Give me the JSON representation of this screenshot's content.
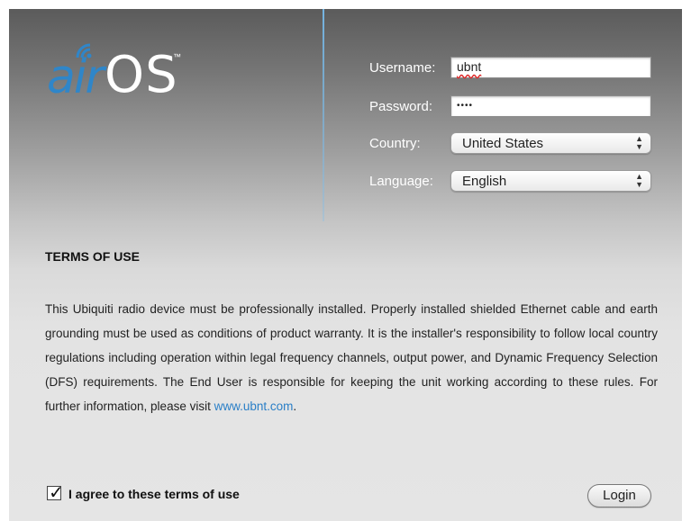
{
  "logo": {
    "air": "air",
    "os": "OS",
    "tm": "™"
  },
  "login": {
    "username_label": "Username:",
    "username_value": "ubnt",
    "password_label": "Password:",
    "password_value": "••••",
    "country_label": "Country:",
    "country_value": "United States",
    "language_label": "Language:",
    "language_value": "English"
  },
  "terms": {
    "heading": "TERMS OF USE",
    "body": "This Ubiquiti radio device must be professionally installed. Properly installed shielded Ethernet cable and earth grounding must be used as conditions of product warranty. It is the installer's responsibility to follow local country regulations including operation within legal frequency channels, output power, and Dynamic Frequency Selection (DFS) requirements. The End User is responsible for keeping the unit working according to these rules. For further information, please visit ",
    "link": "www.ubnt.com",
    "tail": "."
  },
  "agree": {
    "label": "I agree to these terms of use",
    "checked": true
  },
  "login_button": "Login",
  "colors": {
    "accent": "#2f86c9",
    "link": "#2a7fc7"
  }
}
